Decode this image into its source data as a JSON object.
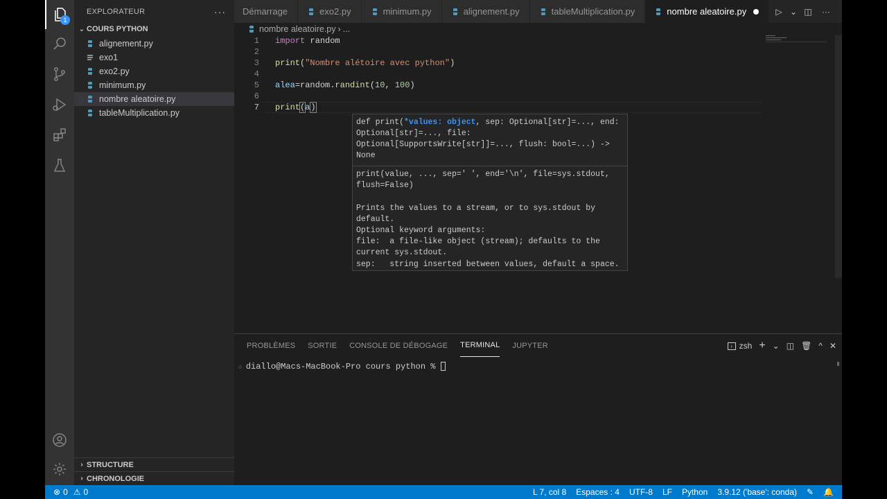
{
  "sidebar": {
    "title": "EXPLORATEUR",
    "folder": "COURS PYTHON",
    "files": [
      {
        "name": "alignement.py",
        "type": "py"
      },
      {
        "name": "exo1",
        "type": "txt"
      },
      {
        "name": "exo2.py",
        "type": "py"
      },
      {
        "name": "minimum.py",
        "type": "py"
      },
      {
        "name": "nombre aleatoire.py",
        "type": "py",
        "selected": true
      },
      {
        "name": "tableMultiplication.py",
        "type": "py"
      }
    ],
    "outline": "STRUCTURE",
    "timeline": "CHRONOLOGIE"
  },
  "activity": {
    "explorer_badge": "1"
  },
  "tabs": [
    {
      "label": "Démarrage"
    },
    {
      "label": "exo2.py"
    },
    {
      "label": "minimum.py"
    },
    {
      "label": "alignement.py"
    },
    {
      "label": "tableMultiplication.py"
    },
    {
      "label": "nombre aleatoire.py",
      "active": true
    }
  ],
  "breadcrumb": {
    "file": "nombre aleatoire.py",
    "rest": "..."
  },
  "editor": {
    "line_numbers": [
      "1",
      "2",
      "3",
      "4",
      "5",
      "6",
      "7"
    ],
    "line1": {
      "kw": "import",
      "rest": " random"
    },
    "line3": {
      "fn": "print",
      "open": "(",
      "str": "\"Nombre alétoire avec python\"",
      "close": ")"
    },
    "line5": {
      "var": "alea",
      "mid": "=random.",
      "fn": "randint",
      "open": "(",
      "n1": "10",
      "sep": ", ",
      "n2": "100",
      "close": ")"
    },
    "line7": {
      "fn": "print",
      "open": "(",
      "arg": "a",
      "close": ")"
    }
  },
  "hover": {
    "sig_pre": "def print(",
    "sig_param": "*values: object",
    "sig_post": ", sep: Optional[str]=..., end: Optional[str]=..., file: Optional[SupportsWrite[str]]=..., flush: bool=...) -> None",
    "doc": "print(value, ..., sep=' ', end='\\n', file=sys.stdout,\nflush=False)\n\nPrints the values to a stream, or to sys.stdout by\ndefault.\nOptional keyword arguments:\nfile:  a file-like object (stream); defaults to the\ncurrent sys.stdout.\nsep:   string inserted between values, default a space.\nend:   string appended after the last value, default a\nnewline."
  },
  "panel": {
    "tabs": [
      "PROBLÈMES",
      "SORTIE",
      "CONSOLE DE DÉBOGAGE",
      "TERMINAL",
      "JUPYTER"
    ],
    "active_tab": "TERMINAL",
    "shell": "zsh",
    "prompt": "diallo@Macs-MacBook-Pro cours python % "
  },
  "status": {
    "errors": "0",
    "warnings": "0",
    "position": "L 7, col 8",
    "spaces": "Espaces : 4",
    "encoding": "UTF-8",
    "eol": "LF",
    "language": "Python",
    "interpreter": "3.9.12 ('base': conda)"
  },
  "colors": {
    "accent": "#007acc",
    "python_icon": "#519aba",
    "active_param": "#3794ff"
  }
}
